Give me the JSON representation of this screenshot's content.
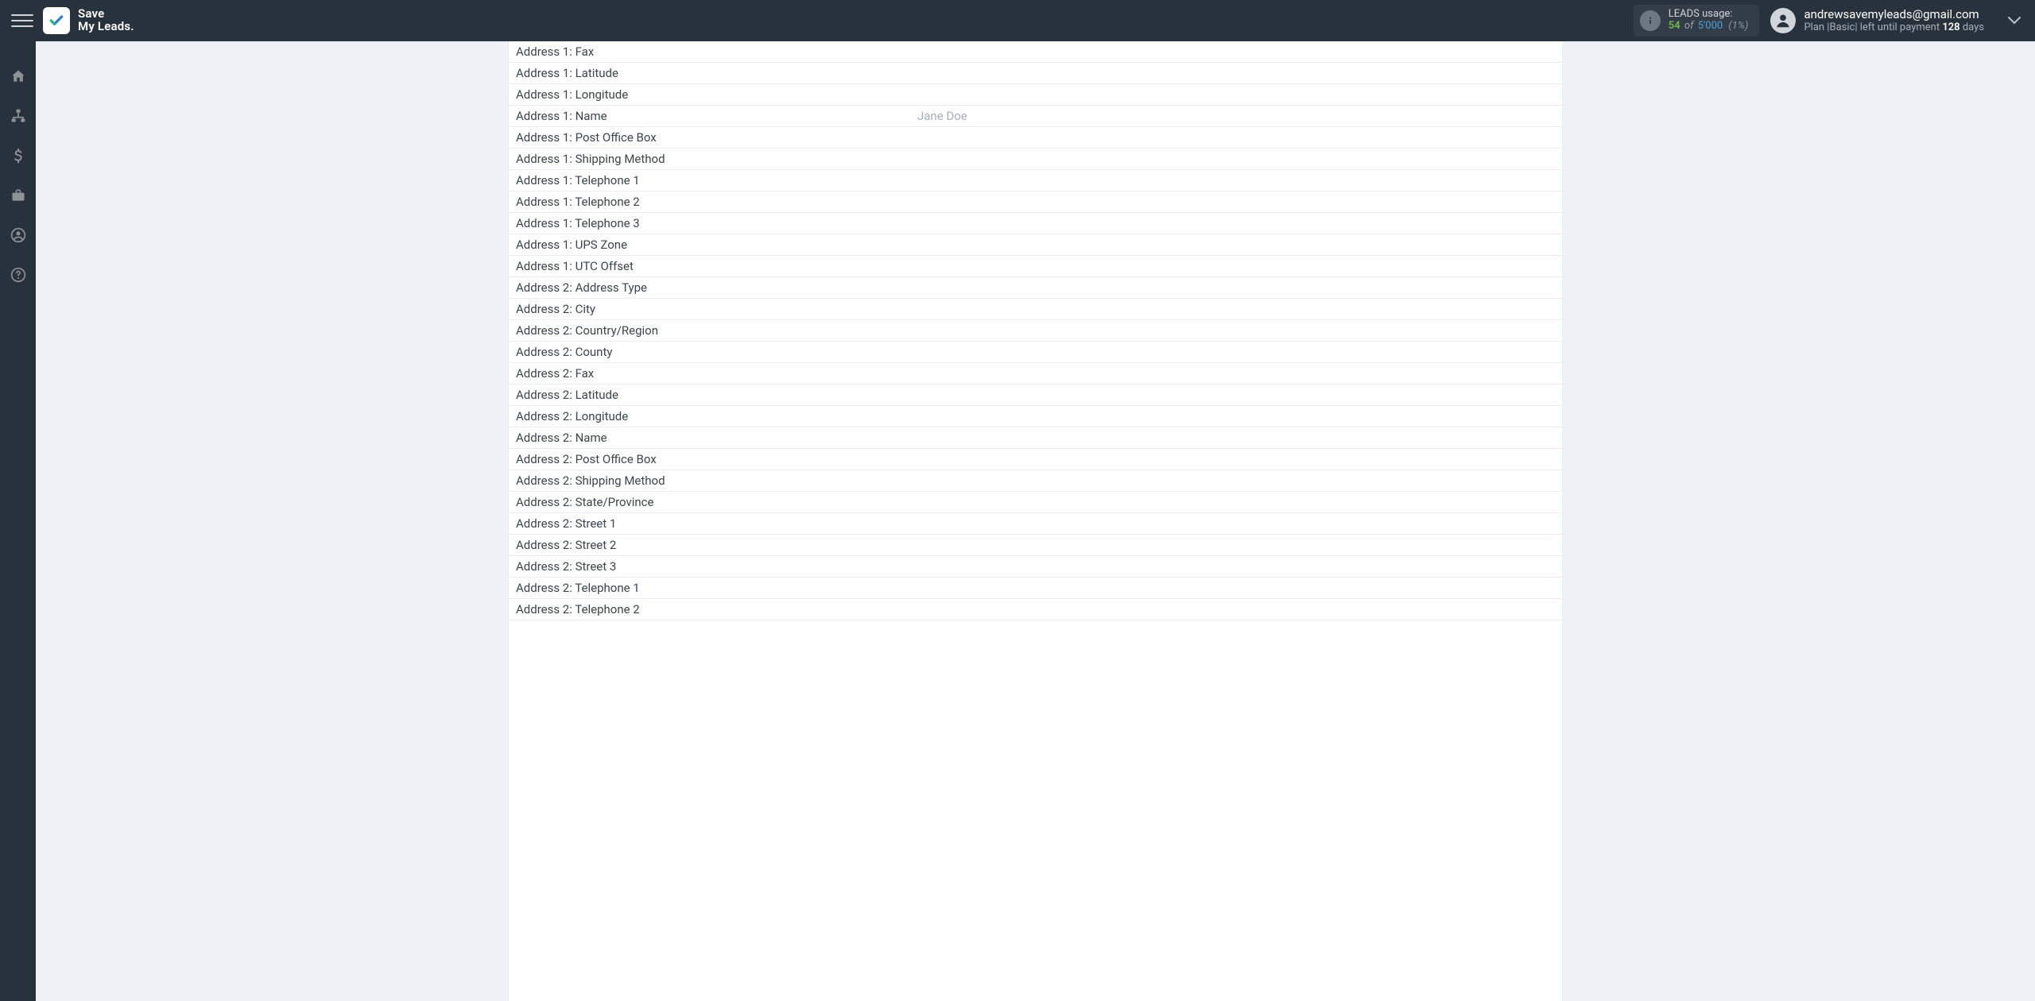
{
  "brand": {
    "line1": "Save",
    "line2": "My Leads."
  },
  "leads": {
    "title": "LEADS usage:",
    "used": "54",
    "of": "of",
    "total": "5'000",
    "pct": "(1%)"
  },
  "user": {
    "email": "andrewsavemyleads@gmail.com",
    "plan_prefix": "Plan |",
    "plan_name": "Basic",
    "plan_mid": "| left until payment ",
    "days": "128",
    "plan_suffix": " days"
  },
  "rows": [
    {
      "label": "Address 1: Fax",
      "value": ""
    },
    {
      "label": "Address 1: Latitude",
      "value": ""
    },
    {
      "label": "Address 1: Longitude",
      "value": ""
    },
    {
      "label": "Address 1: Name",
      "value": "Jane Doe"
    },
    {
      "label": "Address 1: Post Office Box",
      "value": ""
    },
    {
      "label": "Address 1: Shipping Method",
      "value": ""
    },
    {
      "label": "Address 1: Telephone 1",
      "value": ""
    },
    {
      "label": "Address 1: Telephone 2",
      "value": ""
    },
    {
      "label": "Address 1: Telephone 3",
      "value": ""
    },
    {
      "label": "Address 1: UPS Zone",
      "value": ""
    },
    {
      "label": "Address 1: UTC Offset",
      "value": ""
    },
    {
      "label": "Address 2: Address Type",
      "value": ""
    },
    {
      "label": "Address 2: City",
      "value": ""
    },
    {
      "label": "Address 2: Country/Region",
      "value": ""
    },
    {
      "label": "Address 2: County",
      "value": ""
    },
    {
      "label": "Address 2: Fax",
      "value": ""
    },
    {
      "label": "Address 2: Latitude",
      "value": ""
    },
    {
      "label": "Address 2: Longitude",
      "value": ""
    },
    {
      "label": "Address 2: Name",
      "value": ""
    },
    {
      "label": "Address 2: Post Office Box",
      "value": ""
    },
    {
      "label": "Address 2: Shipping Method",
      "value": ""
    },
    {
      "label": "Address 2: State/Province",
      "value": ""
    },
    {
      "label": "Address 2: Street 1",
      "value": ""
    },
    {
      "label": "Address 2: Street 2",
      "value": ""
    },
    {
      "label": "Address 2: Street 3",
      "value": ""
    },
    {
      "label": "Address 2: Telephone 1",
      "value": ""
    },
    {
      "label": "Address 2: Telephone 2",
      "value": ""
    }
  ]
}
